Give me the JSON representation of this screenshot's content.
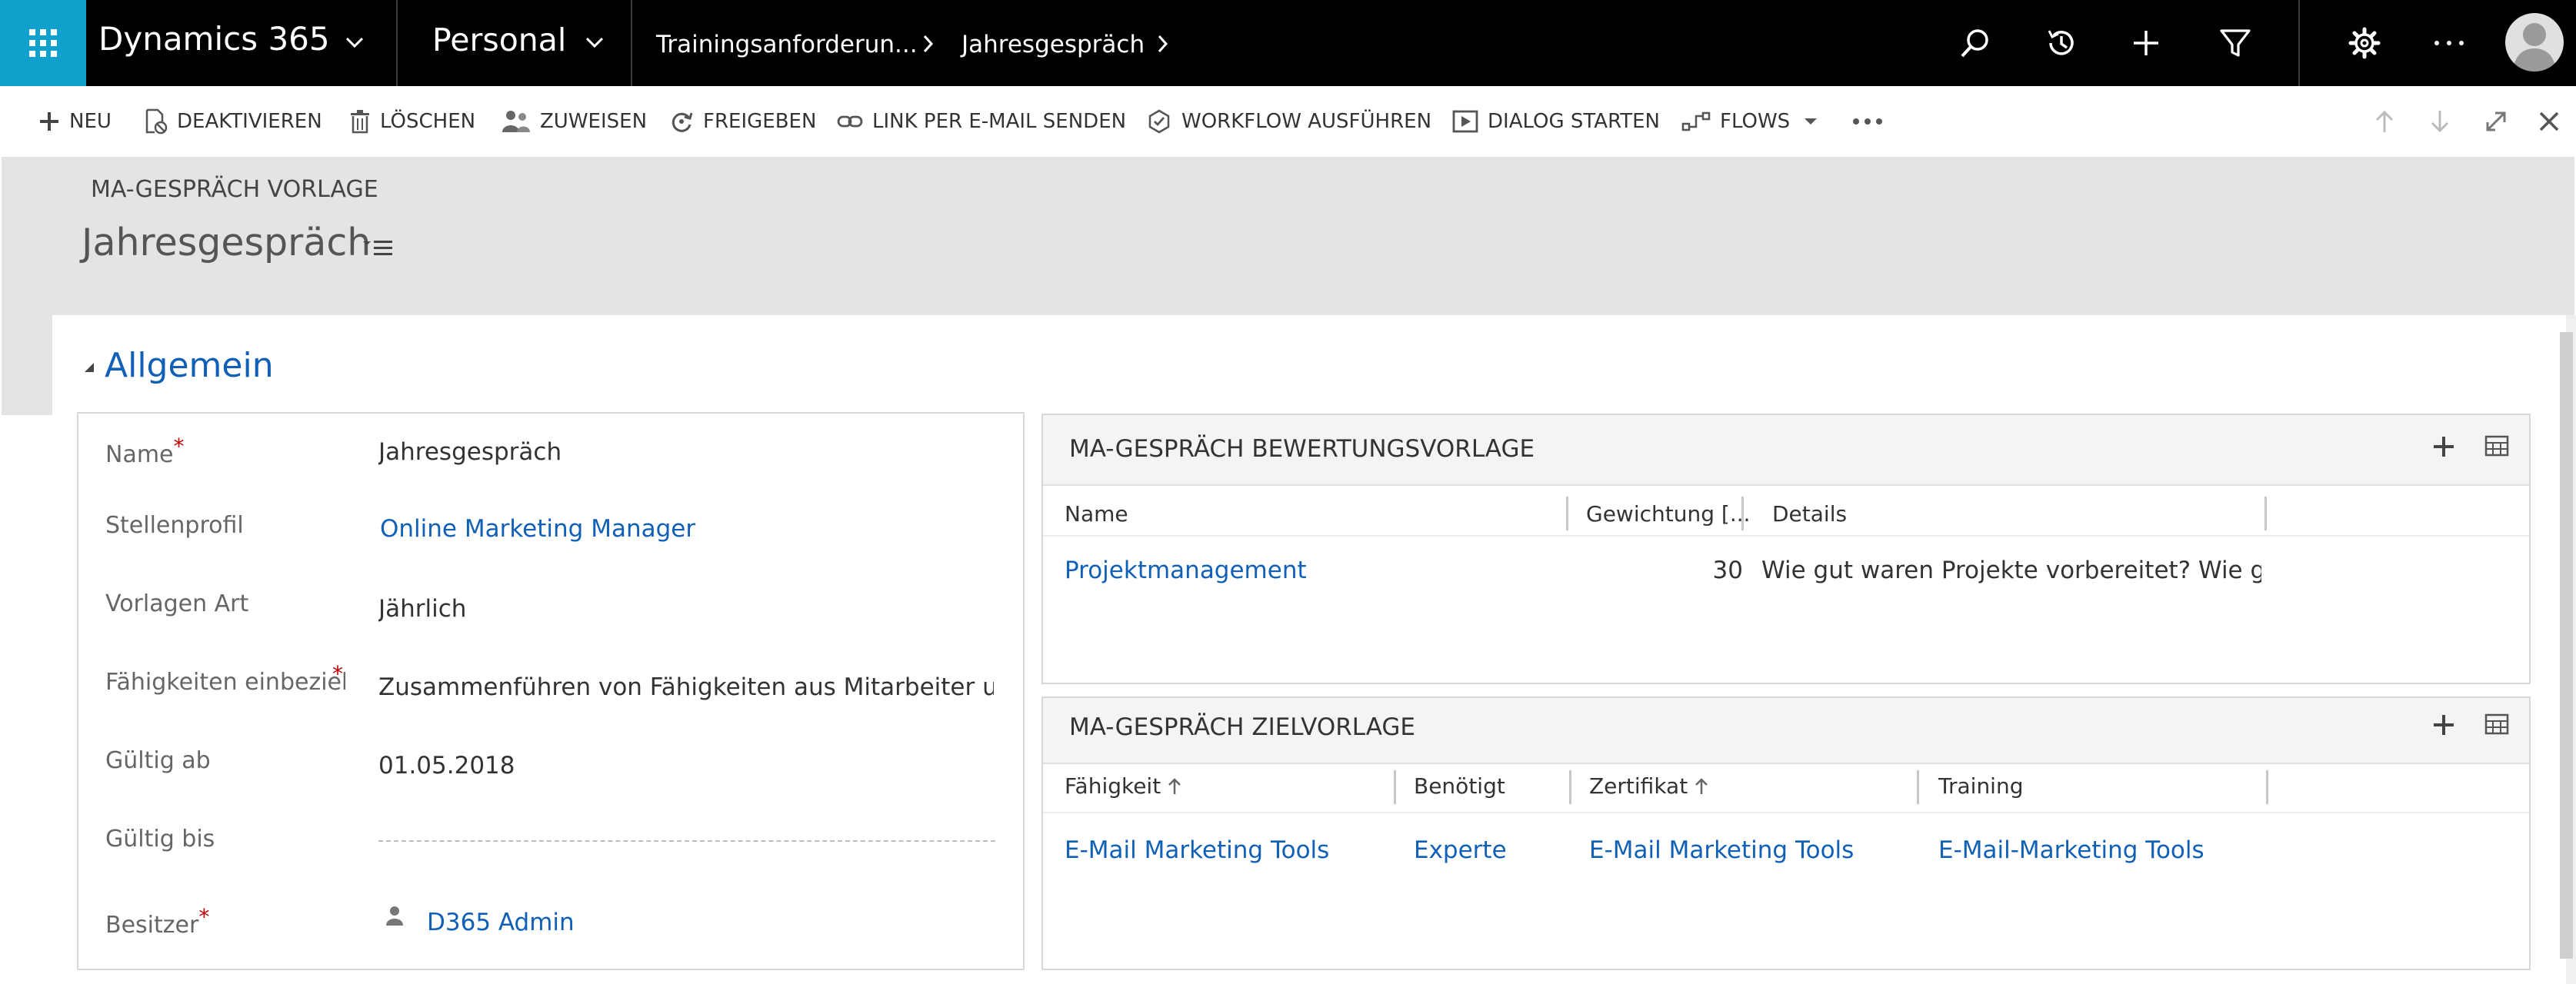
{
  "topbar": {
    "app_name": "Dynamics 365",
    "area": "Personal",
    "breadcrumb": [
      {
        "label": "Trainingsanforderun..."
      },
      {
        "label": "Jahresgespräch"
      }
    ]
  },
  "commands": [
    {
      "label": "NEU",
      "icon": "plus-icon"
    },
    {
      "label": "DEAKTIVIEREN",
      "icon": "deactivate-icon"
    },
    {
      "label": "LÖSCHEN",
      "icon": "trash-icon"
    },
    {
      "label": "ZUWEISEN",
      "icon": "assign-icon"
    },
    {
      "label": "FREIGEBEN",
      "icon": "share-icon"
    },
    {
      "label": "LINK PER E-MAIL SENDEN",
      "icon": "link-icon"
    },
    {
      "label": "WORKFLOW AUSFÜHREN",
      "icon": "workflow-icon"
    },
    {
      "label": "DIALOG STARTEN",
      "icon": "dialog-icon"
    },
    {
      "label": "FLOWS",
      "icon": "flows-icon"
    }
  ],
  "header": {
    "entity": "MA-GESPRÄCH VORLAGE",
    "record_name": "Jahresgespräch"
  },
  "section": {
    "title": "Allgemein"
  },
  "fields": [
    {
      "label": "Name",
      "value": "Jahresgespräch",
      "required": "*"
    },
    {
      "label": "Stellenprofil",
      "value": "Online Marketing Manager"
    },
    {
      "label": "Vorlagen Art",
      "value": "Jährlich"
    },
    {
      "label": "Fähigkeiten einbeziehe",
      "value": "Zusammenführen von Fähigkeiten aus Mitarbeiter und Vo",
      "required": "*"
    },
    {
      "label": "Gültig ab",
      "value": "01.05.2018"
    },
    {
      "label": "Gültig bis",
      "value": ""
    },
    {
      "label": "Besitzer",
      "value": "D365 Admin",
      "required": "*"
    }
  ],
  "grid1": {
    "title": "MA-GESPRÄCH BEWERTUNGSVORLAGE",
    "columns": [
      "Name",
      "Gewichtung [...",
      "Details"
    ],
    "rows": [
      {
        "name": "Projektmanagement",
        "weight": "30",
        "details": "Wie gut waren Projekte vorbereitet? Wie g..."
      }
    ]
  },
  "grid2": {
    "title": "MA-GESPRÄCH ZIELVORLAGE",
    "columns": [
      "Fähigkeit",
      "Benötigt",
      "Zertifikat",
      "Training"
    ],
    "rows": [
      {
        "skill": "E-Mail Marketing Tools",
        "needed": "Experte",
        "certificate": "E-Mail Marketing Tools",
        "training": "E-Mail-Marketing Tools"
      }
    ]
  },
  "colors": {
    "accent": "#0fa1cc",
    "link": "#1160b7",
    "required": "#c00000",
    "topbar": "#000000"
  }
}
